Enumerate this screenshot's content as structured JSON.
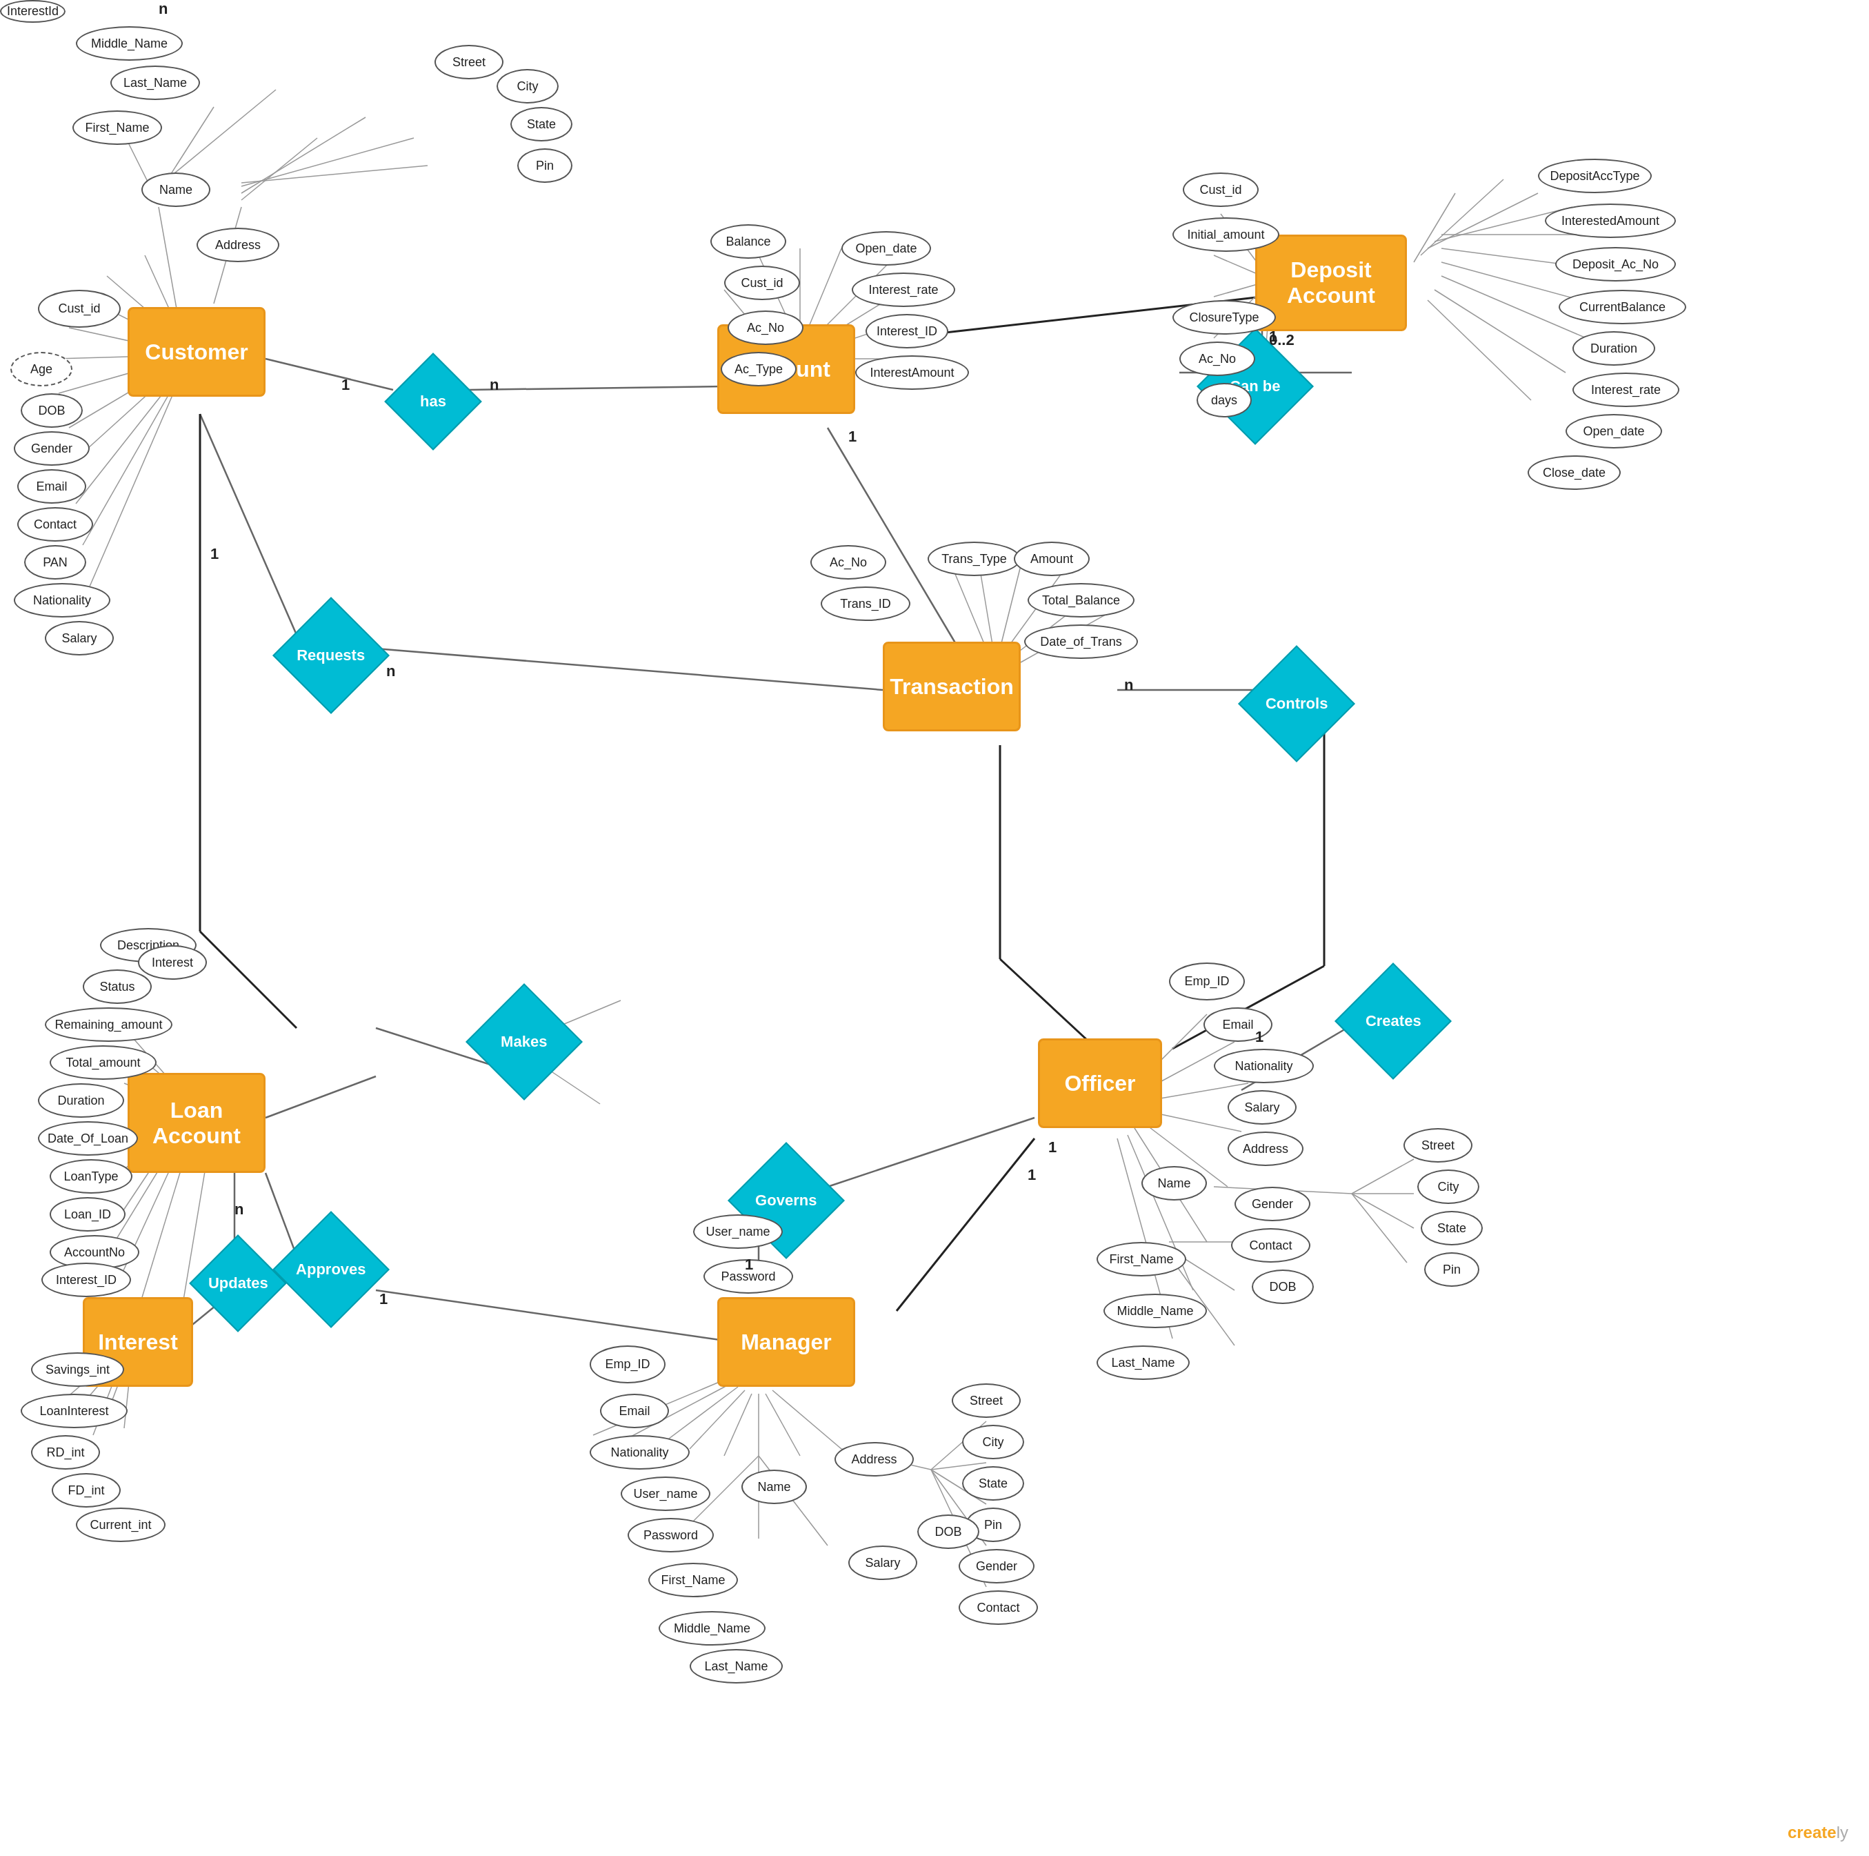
{
  "entities": {
    "customer": {
      "label": "Customer"
    },
    "account": {
      "label": "Account"
    },
    "depositAccount": {
      "label": "Deposit\nAccount"
    },
    "transaction": {
      "label": "Transaction"
    },
    "loanAccount": {
      "label": "Loan\nAccount"
    },
    "officer": {
      "label": "Officer"
    },
    "manager": {
      "label": "Manager"
    },
    "interest": {
      "label": "Interest"
    }
  },
  "relationships": {
    "has": {
      "label": "has"
    },
    "requests": {
      "label": "Requests"
    },
    "controls": {
      "label": "Controls"
    },
    "canBe": {
      "label": "Can be"
    },
    "makes": {
      "label": "Makes"
    },
    "approves": {
      "label": "Approves"
    },
    "governs": {
      "label": "Governs"
    },
    "creates": {
      "label": "Creates"
    },
    "updates": {
      "label": "Updates"
    }
  },
  "attributes": {
    "customer": {
      "cust_id": "Cust_id",
      "age": "Age",
      "dob": "DOB",
      "gender": "Gender",
      "email": "Email",
      "contact": "Contact",
      "pan": "PAN",
      "nationality": "Nationality",
      "salary": "Salary",
      "name": "Name",
      "firstName": "First_Name",
      "lastName": "Last_Name",
      "middleName": "Middle_Name",
      "address": "Address",
      "street": "Street",
      "city": "City",
      "state": "State",
      "pin": "Pin"
    },
    "account": {
      "balance": "Balance",
      "custId": "Cust_id",
      "acNo": "Ac_No",
      "acType": "Ac_Type",
      "openDate": "Open_date",
      "interestRate": "Interest_rate",
      "interestId": "Interest_ID",
      "interestAmount": "InterestAmount"
    },
    "depositAccount": {
      "custId": "Cust_id",
      "initialAmount": "Initial_amount",
      "interestId": "InterestId",
      "closureType": "ClosureType",
      "acNo": "Ac_No",
      "days": "days",
      "depAccType": "DepositAccType",
      "interestedAmount": "InterestedAmount",
      "depositAcNo": "Deposit_Ac_No",
      "currentBalance": "CurrentBalance",
      "duration": "Duration",
      "interestRate": "Interest_rate",
      "openDate": "Open_date",
      "closeDate": "Close_date"
    },
    "transaction": {
      "acNo": "Ac_No",
      "transId": "Trans_ID",
      "transType": "Trans_Type",
      "amount": "Amount",
      "totalBalance": "Total_Balance",
      "dateOfTrans": "Date_of_Trans"
    },
    "loanAccount": {
      "description": "Description",
      "status": "Status",
      "remainingAmount": "Remaining_amount",
      "totalAmount": "Total_amount",
      "duration": "Duration",
      "dateOfLoan": "Date_Of_Loan",
      "loanType": "LoanType",
      "loanId": "Loan_ID",
      "accountNo": "AccountNo",
      "interest": "Interest"
    },
    "interest": {
      "interestId": "Interest_ID",
      "savingsInt": "Savings_int",
      "loanInterest": "LoanInterest",
      "rdInt": "RD_int",
      "fdInt": "FD_int",
      "currentInt": "Current_int"
    },
    "officer": {
      "empId": "Emp_ID",
      "email": "Email",
      "nationality": "Nationality",
      "salary": "Salary",
      "address": "Address",
      "gender": "Gender",
      "contact": "Contact",
      "dob": "DOB",
      "name": "Name",
      "firstName": "First_Name",
      "middleName": "Middle_Name",
      "lastName": "Last_Name",
      "street": "Street",
      "city": "City",
      "state": "State",
      "pin": "Pin"
    },
    "governs": {
      "userName": "User_name",
      "password": "Password"
    },
    "manager": {
      "empId": "Emp_ID",
      "email": "Email",
      "nationality": "Nationality",
      "userName": "User_name",
      "password": "Password",
      "firstName": "First_Name",
      "middleName": "Middle_Name",
      "lastName": "Last_Name",
      "name": "Name",
      "address": "Address",
      "street": "Street",
      "city": "City",
      "state": "State",
      "pin": "Pin",
      "gender": "Gender",
      "contact": "Contact",
      "dob": "DOB",
      "salary": "Salary"
    }
  },
  "cardinalities": {
    "customerHas": "1",
    "hasAccount": "n",
    "customerReq": "1",
    "reqTrans": "n",
    "accTrans": "1",
    "transCtrl": "n",
    "accDep": "1",
    "officerMgr1": "1",
    "officerMgr2": "1",
    "officerCreates": "1",
    "loanApproves": "n",
    "approvesMgr": "1",
    "mgrGov": "1",
    "intUpdates": "n",
    "depCanBe": "0..2"
  }
}
